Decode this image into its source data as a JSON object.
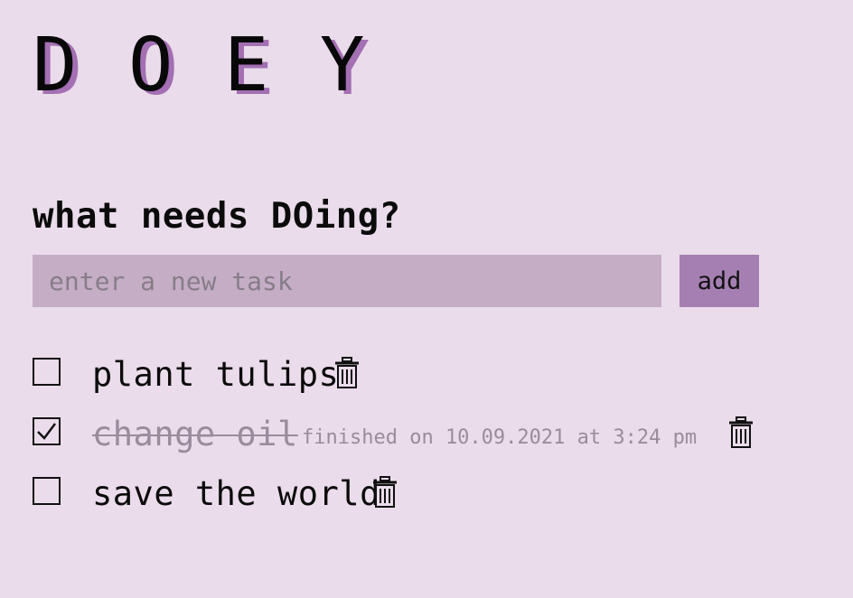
{
  "app": {
    "logo_letters": [
      "D",
      "O",
      "E",
      "Y"
    ]
  },
  "prompt": "what needs DOing?",
  "add_task": {
    "placeholder": "enter a new task",
    "value": "",
    "button_label": "add"
  },
  "tasks": [
    {
      "text": "plant tulips",
      "done": false,
      "finished_text": ""
    },
    {
      "text": "change oil",
      "done": true,
      "finished_text": "finished on 10.09.2021 at 3:24 pm"
    },
    {
      "text": "save the world",
      "done": false,
      "finished_text": ""
    }
  ],
  "icons": {
    "check": "checkmark-icon",
    "delete": "trash-icon"
  },
  "colors": {
    "background": "#eadcea",
    "accent": "#a67fb2",
    "input_background": "#c5adc6",
    "shadow": "#a46fb3",
    "completed_text": "#9b8b9d"
  }
}
